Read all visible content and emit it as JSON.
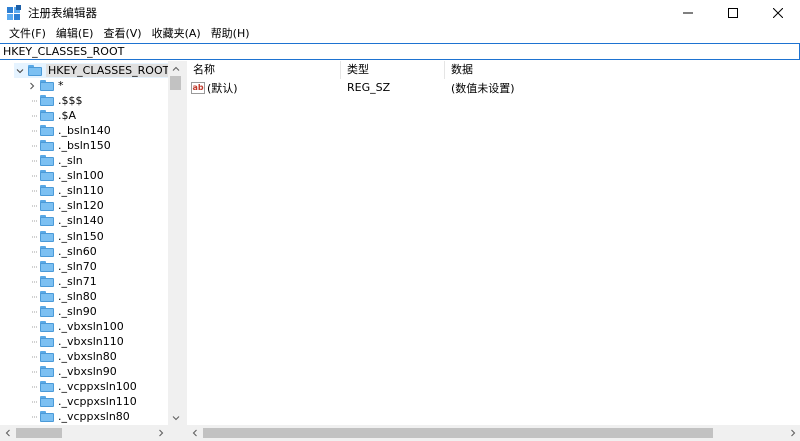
{
  "window": {
    "title": "注册表编辑器",
    "icon": "registry-editor-icon"
  },
  "menu": {
    "items": [
      "文件(F)",
      "编辑(E)",
      "查看(V)",
      "收藏夹(A)",
      "帮助(H)"
    ]
  },
  "address": {
    "path": "HKEY_CLASSES_ROOT"
  },
  "tree": {
    "root_label": "HKEY_CLASSES_ROOT",
    "children": [
      "*",
      ".$$$",
      ".$A",
      "._bsln140",
      "._bsln150",
      "._sln",
      "._sln100",
      "._sln110",
      "._sln120",
      "._sln140",
      "._sln150",
      "._sln60",
      "._sln70",
      "._sln71",
      "._sln80",
      "._sln90",
      "._vbxsln100",
      "._vbxsln110",
      "._vbxsln80",
      "._vbxsln90",
      "._vcppxsln100",
      "._vcppxsln110",
      "._vcppxsln80"
    ]
  },
  "list": {
    "columns": {
      "name": "名称",
      "type": "类型",
      "data": "数据"
    },
    "rows": [
      {
        "name": "(默认)",
        "type": "REG_SZ",
        "data": "(数值未设置)",
        "icon": "string-value-icon",
        "icon_text": "ab"
      }
    ]
  },
  "icons": {
    "minimize": "minimize-icon",
    "maximize": "maximize-icon",
    "close": "close-icon",
    "folder": "folder-icon"
  }
}
